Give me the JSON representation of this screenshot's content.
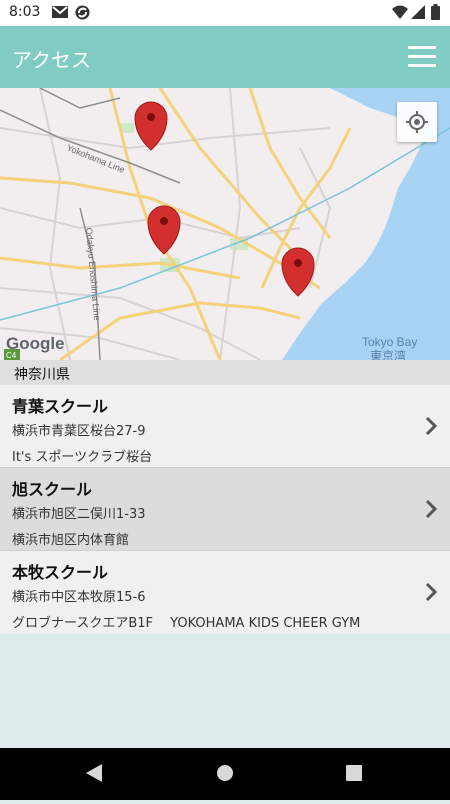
{
  "status_bar": {
    "time": "8:03",
    "icons": [
      "gmail-icon",
      "sync-icon",
      "wifi-icon",
      "signal-icon",
      "battery-icon"
    ]
  },
  "app_bar": {
    "title": "アクセス",
    "menu_icon": "hamburger-menu-icon"
  },
  "map": {
    "labels": {
      "line1": "Yokohama Line",
      "line2": "Odakyu Enoshima Line",
      "bay_en": "Tokyo Bay",
      "bay_jp": "東京湾",
      "brand": "Google",
      "shield": "C4"
    },
    "pins": 3,
    "location_button_icon": "my-location-icon"
  },
  "section": {
    "prefecture": "神奈川県"
  },
  "schools": [
    {
      "name": "青葉スクール",
      "address": "横浜市青葉区桜台27-9",
      "venue": "It's スポーツクラブ桜台"
    },
    {
      "name": "旭スクール",
      "address": "横浜市旭区二俣川1-33",
      "venue": "横浜市旭区内体育館"
    },
    {
      "name": "本牧スクール",
      "address": "横浜市中区本牧原15-6",
      "venue": "グロブナースクエアB1F　 YOKOHAMA KIDS CHEER GYM"
    }
  ],
  "colors": {
    "app_bar": "#80cbc4",
    "background": "#ddeceb",
    "pin": "#d32f2f",
    "water": "#a9d3f5"
  }
}
